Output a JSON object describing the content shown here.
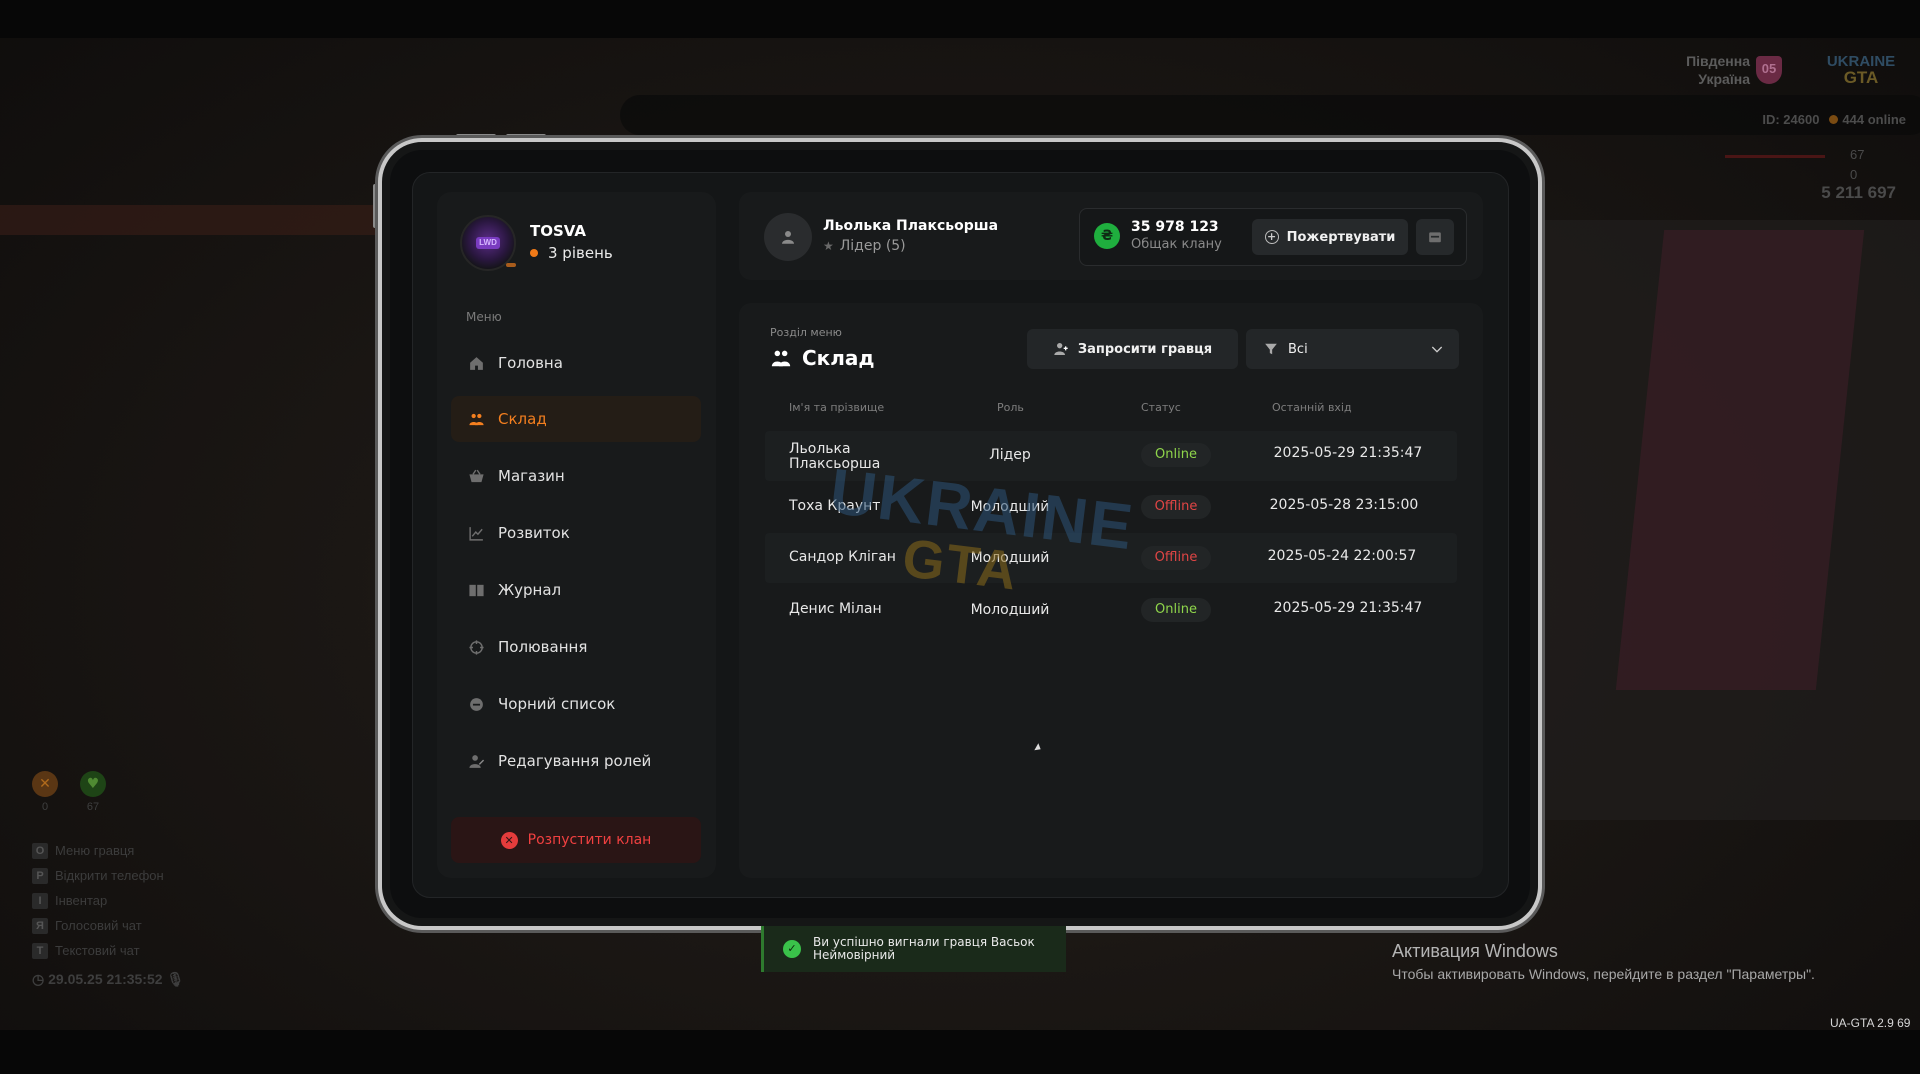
{
  "hud": {
    "region_line1": "Південна",
    "region_line2": "Україна",
    "region_badge": "05",
    "logo_line1": "UKRAINE",
    "logo_line2": "GTA",
    "player_id": "ID: 24600",
    "online": "444 online",
    "health": "67",
    "armor": "0",
    "money": "5 211 697",
    "hunger": "0",
    "thirst": "67",
    "keys": [
      {
        "key": "O",
        "label": "Меню гравця"
      },
      {
        "key": "P",
        "label": "Відкрити телефон"
      },
      {
        "key": "I",
        "label": "Інвентар"
      },
      {
        "key": "Я",
        "label": "Голосовий чат"
      },
      {
        "key": "T",
        "label": "Текстовий чат"
      }
    ],
    "datetime": "29.05.25 21:35:52"
  },
  "windows": {
    "title": "Активация Windows",
    "subtitle": "Чтобы активировать Windows, перейдите в раздел \"Параметры\"."
  },
  "version": "UA-GTA 2.9   69",
  "profile": {
    "name": "TOSVA",
    "level": "3 рівень",
    "avatar_text": "LWD"
  },
  "sidebar": {
    "menu_title": "Меню",
    "items": [
      {
        "label": "Головна",
        "icon": "home-icon",
        "active": false
      },
      {
        "label": "Склад",
        "icon": "people-icon",
        "active": true
      },
      {
        "label": "Магазин",
        "icon": "basket-icon",
        "active": false
      },
      {
        "label": "Розвиток",
        "icon": "chart-icon",
        "active": false
      },
      {
        "label": "Журнал",
        "icon": "book-icon",
        "active": false
      },
      {
        "label": "Полювання",
        "icon": "crosshair-icon",
        "active": false
      },
      {
        "label": "Чорний список",
        "icon": "blocked-icon",
        "active": false
      },
      {
        "label": "Редагування ролей",
        "icon": "user-edit-icon",
        "active": false
      }
    ],
    "disband_label": "Розпустити клан"
  },
  "topbar": {
    "leader_name": "Льолька Плаксьорша",
    "leader_role": "Лідер (5)",
    "currency_symbol": "₴",
    "balance_value": "35 978 123",
    "balance_label": "Общак клану",
    "donate_label": "Пожертвувати"
  },
  "section": {
    "label": "Розділ меню",
    "title": "Склад",
    "invite_label": "Запросити гравця",
    "filter_value": "Всі"
  },
  "table": {
    "headers": {
      "name": "Ім'я та прізвище",
      "role": "Роль",
      "status": "Статус",
      "last_login": "Останній вхід"
    },
    "rows": [
      {
        "name": "Льолька Плаксьорша",
        "role": "Лідер",
        "status": "Online",
        "last_login": "2025-05-29 21:35:47"
      },
      {
        "name": "Тоха Краунт",
        "role": "Молодший",
        "status": "Offline",
        "last_login": "2025-05-28 23:15:00"
      },
      {
        "name": "Сандор Кліган",
        "role": "Молодший",
        "status": "Offline",
        "last_login": "2025-05-24 22:00:57"
      },
      {
        "name": "Денис Мілан",
        "role": "Молодший",
        "status": "Online",
        "last_login": "2025-05-29 21:35:47"
      }
    ]
  },
  "watermark": {
    "line1": "UKRAINE",
    "line2": "GTA"
  },
  "toast": {
    "message": "Ви успішно вигнали гравця Васьок Неймовірний"
  },
  "colors": {
    "accent": "#f47f1f",
    "online": "#8fd64b",
    "offline": "#e14545",
    "danger": "#f04040",
    "currency": "#1fae3e"
  }
}
